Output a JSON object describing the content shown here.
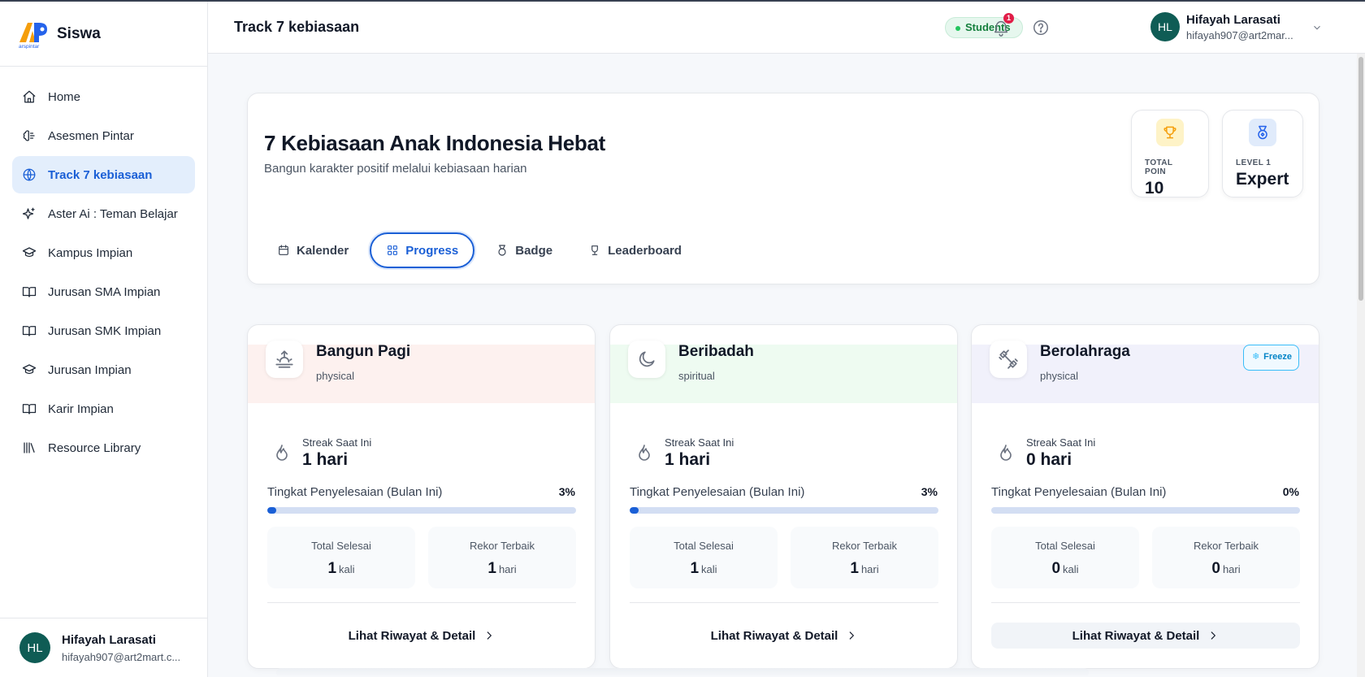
{
  "brand": {
    "name": "Siswa",
    "logo_text": "arspintar"
  },
  "sidebar": {
    "items": [
      {
        "label": "Home",
        "icon": "home-icon"
      },
      {
        "label": "Asesmen Pintar",
        "icon": "brain-icon"
      },
      {
        "label": "Track 7 kebiasaan",
        "icon": "globe-icon",
        "active": true
      },
      {
        "label": "Aster Ai : Teman Belajar",
        "icon": "sparkles-icon"
      },
      {
        "label": "Kampus Impian",
        "icon": "graduation-cap-icon"
      },
      {
        "label": "Jurusan SMA Impian",
        "icon": "book-open-icon"
      },
      {
        "label": "Jurusan SMK Impian",
        "icon": "book-open-icon"
      },
      {
        "label": "Jurusan Impian",
        "icon": "graduation-cap-icon"
      },
      {
        "label": "Karir Impian",
        "icon": "book-open-icon"
      },
      {
        "label": "Resource Library",
        "icon": "library-icon"
      }
    ],
    "user": {
      "initials": "HL",
      "name": "Hifayah Larasati",
      "email": "hifayah907@art2mart.c..."
    }
  },
  "header": {
    "title": "Track 7 kebiasaan",
    "role": "Students",
    "notification_count": "1",
    "user": {
      "initials": "HL",
      "name": "Hifayah Larasati",
      "email": "hifayah907@art2mar..."
    }
  },
  "hero": {
    "title": "7 Kebiasaan Anak Indonesia Hebat",
    "subtitle": "Bangun karakter positif melalui kebiasaan harian",
    "stats": [
      {
        "label": "TOTAL POIN",
        "value": "10",
        "icon": "trophy-icon",
        "color": "#f59e0b",
        "bg": "#fef3c7"
      },
      {
        "label": "LEVEL 1",
        "value": "Expert",
        "icon": "medal-icon",
        "color": "#2563eb",
        "bg": "#e0ebfb"
      }
    ],
    "tabs": [
      {
        "label": "Kalender",
        "icon": "calendar-icon"
      },
      {
        "label": "Progress",
        "icon": "grid-icon",
        "active": true
      },
      {
        "label": "Badge",
        "icon": "badge-icon"
      },
      {
        "label": "Leaderboard",
        "icon": "trophy-icon"
      }
    ]
  },
  "habits": [
    {
      "name": "Bangun Pagi",
      "category": "physical",
      "icon": "sunrise-icon",
      "band_color": "#fdf1ef",
      "streak_label": "Streak Saat Ini",
      "streak_value": "1 hari",
      "progress_label": "Tingkat Penyelesaian (Bulan Ini)",
      "progress_pct_text": "3%",
      "progress": 3,
      "total_label": "Total Selesai",
      "total_value": "1",
      "total_unit": "kali",
      "record_label": "Rekor Terbaik",
      "record_value": "1",
      "record_unit": "hari",
      "detail_label": "Lihat Riwayat & Detail"
    },
    {
      "name": "Beribadah",
      "category": "spiritual",
      "icon": "moon-icon",
      "band_color": "#eefbf1",
      "streak_label": "Streak Saat Ini",
      "streak_value": "1 hari",
      "progress_label": "Tingkat Penyelesaian (Bulan Ini)",
      "progress_pct_text": "3%",
      "progress": 3,
      "total_label": "Total Selesai",
      "total_value": "1",
      "total_unit": "kali",
      "record_label": "Rekor Terbaik",
      "record_value": "1",
      "record_unit": "hari",
      "detail_label": "Lihat Riwayat & Detail"
    },
    {
      "name": "Berolahraga",
      "category": "physical",
      "icon": "dumbbell-icon",
      "band_color": "#f1f1fb",
      "freeze_label": "Freeze",
      "streak_label": "Streak Saat Ini",
      "streak_value": "0 hari",
      "progress_label": "Tingkat Penyelesaian (Bulan Ini)",
      "progress_pct_text": "0%",
      "progress": 0,
      "total_label": "Total Selesai",
      "total_value": "0",
      "total_unit": "kali",
      "record_label": "Rekor Terbaik",
      "record_value": "0",
      "record_unit": "hari",
      "detail_label": "Lihat Riwayat & Detail"
    }
  ]
}
